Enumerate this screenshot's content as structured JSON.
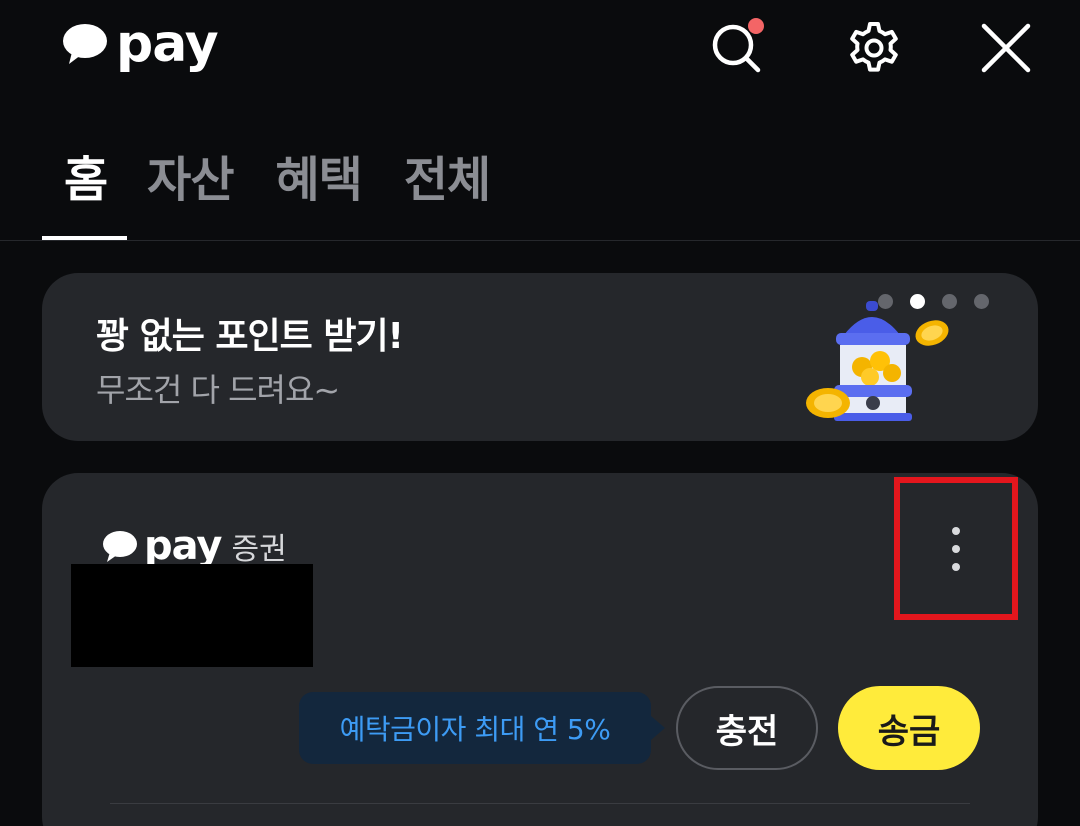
{
  "header": {
    "logo_text": "pay",
    "icons": [
      "search-icon",
      "gear-icon",
      "close-icon"
    ],
    "notification_dot_color": "#f36566"
  },
  "tabs": [
    {
      "label": "홈",
      "active": true
    },
    {
      "label": "자산",
      "active": false
    },
    {
      "label": "혜택",
      "active": false
    },
    {
      "label": "전체",
      "active": false
    }
  ],
  "banner": {
    "title": "꽝 없는 포인트 받기!",
    "subtitle": "무조건 다 드려요~",
    "pager_total": 4,
    "pager_active_index": 1,
    "illustration": "gacha-machine-icon"
  },
  "card": {
    "brand_text": "pay",
    "brand_sub": "증권",
    "more_icon": "more-vertical-icon",
    "tooltip": "예탁금이자 최대 연 5%",
    "charge_label": "충전",
    "send_label": "송금"
  },
  "colors": {
    "background": "#0a0b0d",
    "card": "#25272b",
    "accent_yellow": "#ffeb3b",
    "tooltip_text": "#3d9bf4",
    "highlight_box": "#e3161d"
  }
}
